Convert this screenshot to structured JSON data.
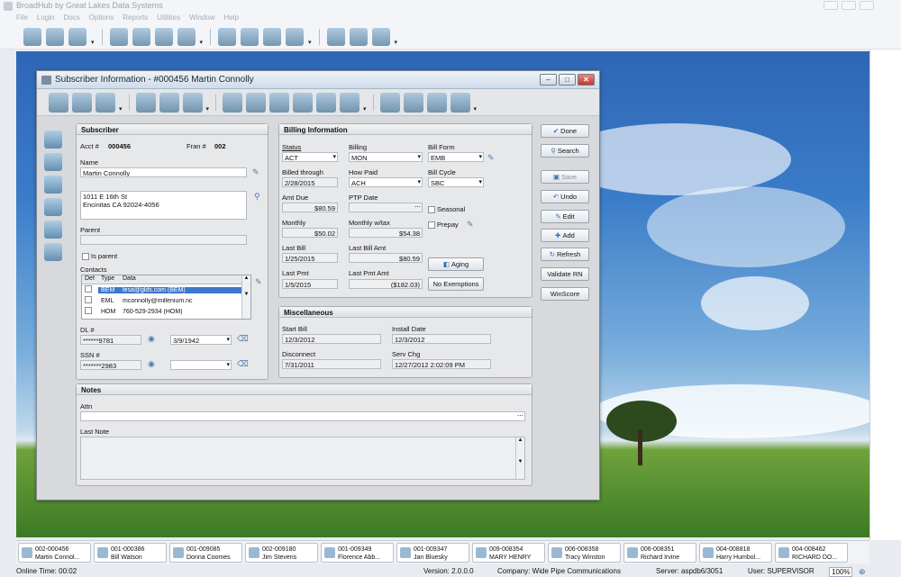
{
  "app": {
    "title": "BroadHub by Great Lakes Data Systems",
    "menu": [
      "File",
      "Login",
      "Docs",
      "Options",
      "Reports",
      "Utilities",
      "Window",
      "Help"
    ]
  },
  "dialog": {
    "title": "Subscriber Information - #000456 Martin Connolly"
  },
  "subscriber": {
    "section_title": "Subscriber",
    "acct_label": "Acct #",
    "acct_value": "000456",
    "fran_label": "Fran #",
    "fran_value": "002",
    "name_label": "Name",
    "name_value": "Martin Connolly",
    "address_line1": "1011 E 16th St",
    "address_line2": "Encinitas CA 92024-4056",
    "parent_label": "Parent",
    "is_parent_label": "Is parent",
    "contacts_label": "Contacts",
    "contacts_headers": [
      "Def",
      "Type",
      "Data"
    ],
    "contacts": [
      {
        "type": "BEM",
        "data": "lesa@glds.com (BEM)"
      },
      {
        "type": "EML",
        "data": "mconnolly@millenium.nc"
      },
      {
        "type": "HOM",
        "data": "760-529-2934 (HOM)"
      }
    ],
    "dl_label": "DL #",
    "dl_value": "******9781",
    "dl_date": "3/9/1942",
    "ssn_label": "SSN #",
    "ssn_value": "*******2983"
  },
  "billing": {
    "section_title": "Billing Information",
    "status_label": "Status",
    "status_value": "ACT",
    "billing_label": "Billing",
    "billing_value": "MON",
    "bill_form_label": "Bill Form",
    "bill_form_value": "EMB",
    "billed_through_label": "Billed through",
    "billed_through_value": "2/28/2015",
    "how_paid_label": "How Paid",
    "how_paid_value": "ACH",
    "bill_cycle_label": "Bill Cycle",
    "bill_cycle_value": "SBC",
    "amt_due_label": "Amt Due",
    "amt_due_value": "$80.59",
    "ptp_date_label": "PTP Date",
    "ptp_date_value": "",
    "seasonal_label": "Seasonal",
    "prepay_label": "Prepay",
    "monthly_label": "Monthly",
    "monthly_value": "$50.02",
    "monthly_tax_label": "Monthly w/tax",
    "monthly_tax_value": "$54.38",
    "last_bill_label": "Last Bill",
    "last_bill_value": "1/25/2015",
    "last_bill_amt_label": "Last Bill Amt",
    "last_bill_amt_value": "$80.59",
    "aging_label": "Aging",
    "last_pmt_label": "Last Pmt",
    "last_pmt_value": "1/5/2015",
    "last_pmt_amt_label": "Last Pmt Amt",
    "last_pmt_amt_value": "($182.03)",
    "no_exemptions_label": "No Exemptions"
  },
  "misc": {
    "section_title": "Miscellaneous",
    "start_bill_label": "Start Bill",
    "start_bill_value": "12/3/2012",
    "install_date_label": "Install Date",
    "install_date_value": "12/3/2012",
    "disconnect_label": "Disconnect",
    "disconnect_value": "7/31/2011",
    "serv_chg_label": "Serv Chg",
    "serv_chg_value": "12/27/2012 2:02:09 PM"
  },
  "notes": {
    "section_title": "Notes",
    "attn_label": "Attn",
    "last_note_label": "Last Note"
  },
  "actions": {
    "done": "Done",
    "search": "Search",
    "save": "Save",
    "undo": "Undo",
    "edit": "Edit",
    "add": "Add",
    "refresh": "Refresh",
    "validate_rn": "Validate RN",
    "winscore": "WinScore"
  },
  "tasks": [
    {
      "id": "002-000456",
      "name": "Martin Connol..."
    },
    {
      "id": "001-000386",
      "name": "Bill Watson"
    },
    {
      "id": "001-009085",
      "name": "Donna Coomes"
    },
    {
      "id": "002-009180",
      "name": "Jim Stevens"
    },
    {
      "id": "001-009349",
      "name": "Florence Abb..."
    },
    {
      "id": "001-009347",
      "name": "Jan Bluesky"
    },
    {
      "id": "009-008354",
      "name": "MARY HENRY"
    },
    {
      "id": "006-008358",
      "name": "Tracy Winston"
    },
    {
      "id": "006-008351",
      "name": "Richard Irvine"
    },
    {
      "id": "004-008818",
      "name": "Harry Humbol..."
    },
    {
      "id": "004-008462",
      "name": "RICHARD DO..."
    }
  ],
  "status": {
    "online_time": "Online Time: 00:02",
    "version": "Version: 2.0.0.0",
    "company": "Company: Wide Pipe Communications",
    "server": "Server: aspdb6/3051",
    "user": "User: SUPERVISOR",
    "zoom": "100%"
  }
}
